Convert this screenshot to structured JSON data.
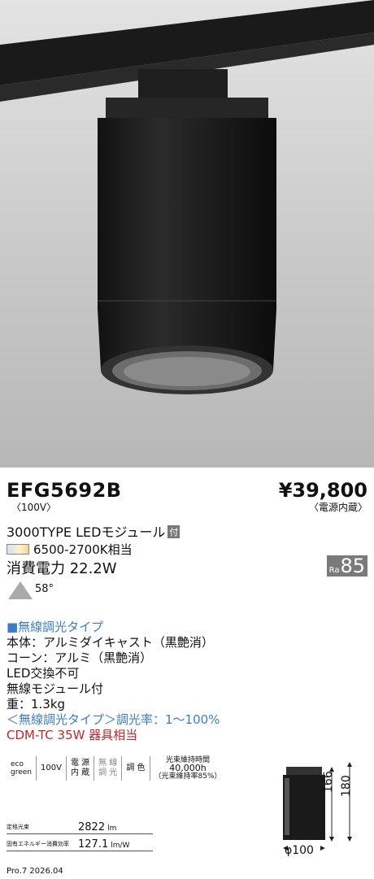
{
  "product": {
    "model": "EFG5692B",
    "voltage": "〈100V〉",
    "price": "¥39,800",
    "price_note": "〈電源内蔵〉",
    "type_line": "3000TYPE LEDモジュール",
    "type_badge": "付",
    "color_temp": "6500-2700K相当",
    "power": "消費電力 22.2W",
    "ra_label": "Ra",
    "ra_value": "85",
    "beam_angle": "58°"
  },
  "spec": {
    "category": "■無線調光タイプ",
    "lines": [
      "本体：アルミダイキャスト（黒艶消）",
      "コーン：アルミ（黒艶消）",
      "LED交換不可",
      "無線モジュール付",
      "重：1.3kg"
    ],
    "dimming": "＜無線調光タイプ＞調光率：1〜100%",
    "equivalent": "CDM-TC 35W 器具相当"
  },
  "icons": {
    "eco_line1": "eco",
    "eco_line2": "green",
    "volt": "100V",
    "builtin_line1": "電 源",
    "builtin_line2": "内 蔵",
    "wireless_line1": "無 線",
    "wireless_line2": "調 光",
    "dimcolor": "調 色",
    "life_label": "光束維持時間",
    "life_value": "40,000h",
    "life_note": "（光束維持率85%）"
  },
  "table": {
    "rows": [
      {
        "label": "定格光束",
        "value": "2822",
        "unit": "lm"
      },
      {
        "label": "固有エネルギー消費効率",
        "value": "127.1",
        "unit": "lm/W"
      }
    ]
  },
  "dimensions": {
    "h1": "166",
    "h2": "180",
    "diameter": "φ100"
  },
  "footer": "Pro.7 2026.04"
}
